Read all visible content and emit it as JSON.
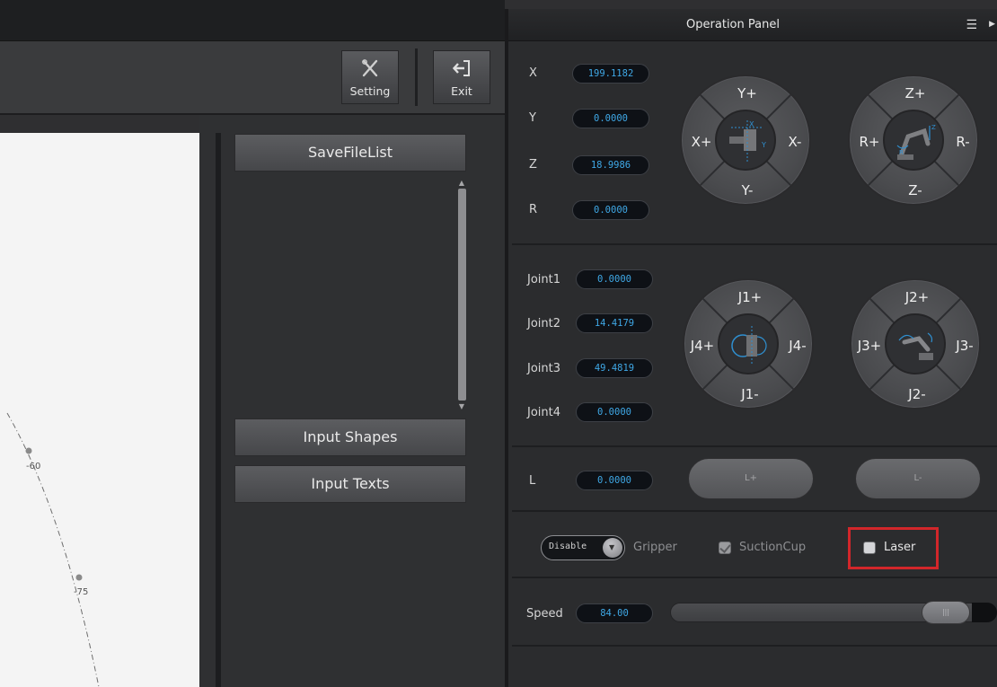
{
  "toolbar": {
    "setting_label": "Setting",
    "exit_label": "Exit"
  },
  "canvas": {
    "marks": [
      "-60",
      "-75"
    ]
  },
  "middle": {
    "save_file_list": "SaveFileList",
    "input_shapes": "Input Shapes",
    "input_texts": "Input Texts"
  },
  "panel": {
    "title": "Operation Panel",
    "cartesian": {
      "labels": [
        "X",
        "Y",
        "Z",
        "R"
      ],
      "values": [
        "199.1182",
        "0.0000",
        "18.9986",
        "0.0000"
      ]
    },
    "xy_dial": {
      "top": "Y+",
      "bottom": "Y-",
      "left": "X+",
      "right": "X-"
    },
    "zr_dial": {
      "top": "Z+",
      "bottom": "Z-",
      "left": "R+",
      "right": "R-"
    },
    "joints": {
      "labels": [
        "Joint1",
        "Joint2",
        "Joint3",
        "Joint4"
      ],
      "values": [
        "0.0000",
        "14.4179",
        "49.4819",
        "0.0000"
      ]
    },
    "j14_dial": {
      "top": "J1+",
      "bottom": "J1-",
      "left": "J4+",
      "right": "J4-"
    },
    "j23_dial": {
      "top": "J2+",
      "bottom": "J2-",
      "left": "J3+",
      "right": "J3-"
    },
    "linear": {
      "label": "L",
      "value": "0.0000",
      "plus": "L+",
      "minus": "L-"
    },
    "effector": {
      "toggle_text": "Disable",
      "gripper": "Gripper",
      "suction_cup": "SuctionCup",
      "laser": "Laser"
    },
    "speed": {
      "label": "Speed",
      "value": "84.00",
      "level_percent": 84,
      "knob_text": "|||"
    }
  },
  "colors": {
    "value_text": "#3fa8e6",
    "highlight_box": "#d2262a"
  }
}
